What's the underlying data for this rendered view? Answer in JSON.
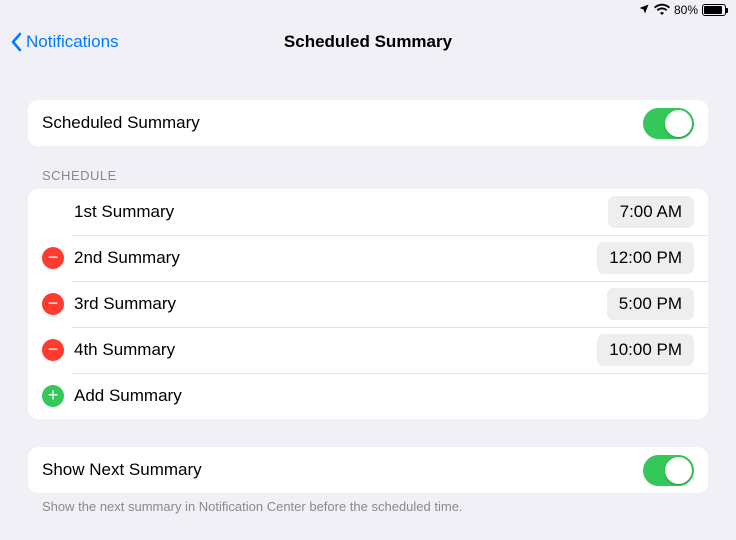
{
  "status": {
    "battery_pct": "80%"
  },
  "nav": {
    "back_label": "Notifications",
    "title": "Scheduled Summary"
  },
  "main_toggle": {
    "label": "Scheduled Summary"
  },
  "schedule_header": "SCHEDULE",
  "schedule": [
    {
      "label": "1st Summary",
      "time": "7:00 AM",
      "removable": false
    },
    {
      "label": "2nd Summary",
      "time": "12:00 PM",
      "removable": true
    },
    {
      "label": "3rd Summary",
      "time": "5:00 PM",
      "removable": true
    },
    {
      "label": "4th Summary",
      "time": "10:00 PM",
      "removable": true
    }
  ],
  "add_label": "Add Summary",
  "show_next": {
    "label": "Show Next Summary",
    "footer": "Show the next summary in Notification Center before the scheduled time."
  }
}
